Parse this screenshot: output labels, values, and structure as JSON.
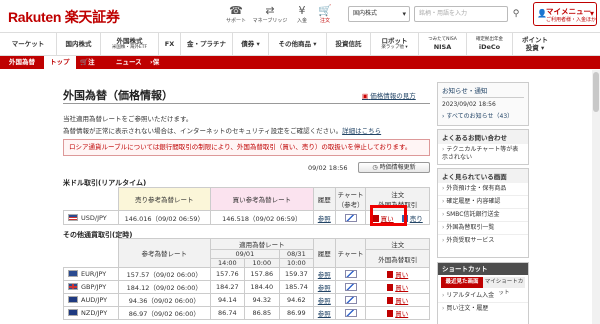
{
  "header": {
    "logo": "Rakuten 楽天証券",
    "icons": [
      {
        "label": "サポート",
        "icon": "headset-icon"
      },
      {
        "label": "マネーブリッジ",
        "icon": "bridge-icon"
      },
      {
        "label": "入金",
        "icon": "deposit-icon"
      },
      {
        "label": "注文",
        "icon": "cart-icon"
      }
    ],
    "search_category": "国内株式",
    "search_placeholder": "銘柄・用語を入力",
    "mymenu_label": "マイメニュー",
    "mymenu_sub": "ご利用者様・入金ほか"
  },
  "nav": [
    {
      "label": "マーケット",
      "sub": ""
    },
    {
      "label": "国内株式",
      "sub": ""
    },
    {
      "label": "外国株式",
      "sub": "米国株・海外ETF"
    },
    {
      "label": "FX",
      "sub": ""
    },
    {
      "label": "金・プラチナ",
      "sub": ""
    },
    {
      "label": "債券 ▾",
      "sub": ""
    },
    {
      "label": "その他商品 ▾",
      "sub": ""
    },
    {
      "label": "投資信託",
      "sub": ""
    },
    {
      "label": "ロボット",
      "sub": "楽ラップ他 ▾"
    },
    {
      "label": "つみたてNISA",
      "sub": "NISA"
    },
    {
      "label": "確定拠出年金",
      "sub": "iDeCo"
    },
    {
      "label": "ポイント",
      "sub": "投資 ▾"
    }
  ],
  "subnav": {
    "section": "外国為替",
    "items": [
      "トップ",
      "注文",
      "ニュース",
      "保有商品一覧"
    ]
  },
  "main": {
    "title": "外国為替（価格情報）",
    "pdf_link": "価格情報の見方",
    "note1": "当社適用為替レートをご参照いただけます。",
    "note2": "為替情報が正常に表示されない場合は、インターネットのセキュリティ設定をご確認ください。",
    "note2_link": "詳細はこちら",
    "alert": "ロシア通貨ルーブルについては銀行間取引の制限により、外国為替取引（買い、売り）の取扱いを停止しております。",
    "timestamp": "09/02 18:56",
    "update_button": "時価情報更新",
    "section_usd": "米ドル取引(リアルタイム)",
    "section_other": "その他通貨取引(定時)"
  },
  "usd_table": {
    "headers": {
      "sell": "売り参考為替レート",
      "buy": "買い参考為替レート",
      "history": "履歴",
      "chart": "チャート",
      "chart_sub": "（参考）",
      "order": "注文",
      "order_sub": "外国為替取引"
    },
    "row": {
      "pair": "USD/JPY",
      "sell": "146.016（09/02 06:59）",
      "buy": "146.518（09/02 06:59）",
      "history": "参照",
      "buy_btn": "買い",
      "sell_btn": "売り"
    }
  },
  "other_table": {
    "headers": {
      "ref": "参考為替レート",
      "applied": "適用為替レート",
      "history": "履歴",
      "chart": "チャート",
      "order": "注文",
      "order_sub": "外国為替取引",
      "date1": "09/01",
      "date2": "08/31",
      "t1400": "14:00",
      "t1000": "10:00"
    },
    "rows": [
      {
        "pair": "EUR/JPY",
        "ref": "157.57（09/02 06:00）",
        "a": "157.76",
        "b": "157.86",
        "c": "159.37",
        "history": "参照",
        "buy": "買い",
        "flag": "eu"
      },
      {
        "pair": "GBP/JPY",
        "ref": "184.12（09/02 06:00）",
        "a": "184.27",
        "b": "184.40",
        "c": "185.74",
        "history": "参照",
        "buy": "買い",
        "flag": "gb"
      },
      {
        "pair": "AUD/JPY",
        "ref": "94.36（09/02 06:00）",
        "a": "94.14",
        "b": "94.32",
        "c": "94.62",
        "history": "参照",
        "buy": "買い",
        "flag": "au"
      },
      {
        "pair": "NZD/JPY",
        "ref": "86.97（09/02 06:00）",
        "a": "86.74",
        "b": "86.85",
        "c": "86.99",
        "history": "参照",
        "buy": "買い",
        "flag": "nz"
      }
    ]
  },
  "sidebar": {
    "notice_title": "お知らせ・通知",
    "notice_date": "2023/09/02 18:56",
    "notice_link": "すべてのお知らせ（43）",
    "faq_title": "よくあるお問い合わせ",
    "faq_item": "テクニカルチャート等が表示されない",
    "pages_title": "よく見られている画面",
    "pages": [
      "外貨預け金・保有商品",
      "確定履歴・内容確認",
      "SMBC信託銀行送金",
      "外国為替取引一覧",
      "外貨受取サービス"
    ],
    "shortcut_title": "ショートカット",
    "shortcut_tab1": "最近見た画面",
    "shortcut_tab2": "マイショートカット",
    "shortcut_items": [
      "リアルタイム入金",
      "買い注文・履歴"
    ]
  }
}
